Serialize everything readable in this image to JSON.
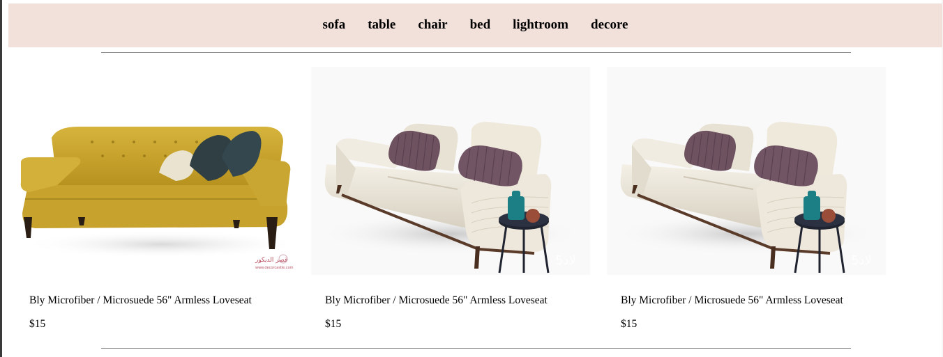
{
  "nav": {
    "items": [
      "sofa",
      "table",
      "chair",
      "bed",
      "lightroom",
      "decore"
    ]
  },
  "products": [
    {
      "title": "Bly Microfiber / Microsuede 56\" Armless Loveseat",
      "price": "$15",
      "image_icon": "yellow-tufted-loveseat-image",
      "image_watermark": "قصر الديكور\nwww.decorcastle.com"
    },
    {
      "title": "Bly Microfiber / Microsuede 56\" Armless Loveseat",
      "price": "$15",
      "image_icon": "cream-modern-sofa-image",
      "image_watermark": "5لاد"
    },
    {
      "title": "Bly Microfiber / Microsuede 56\" Armless Loveseat",
      "price": "$15",
      "image_icon": "cream-modern-sofa-image",
      "image_watermark": "5لاد"
    }
  ],
  "colors": {
    "nav_background": "#f2e1db",
    "yellow_sofa": "#c9a631",
    "cream_sofa": "#ece7dc",
    "pillow_purple": "#6e5260",
    "pillow_dark": "#2f3f44"
  }
}
